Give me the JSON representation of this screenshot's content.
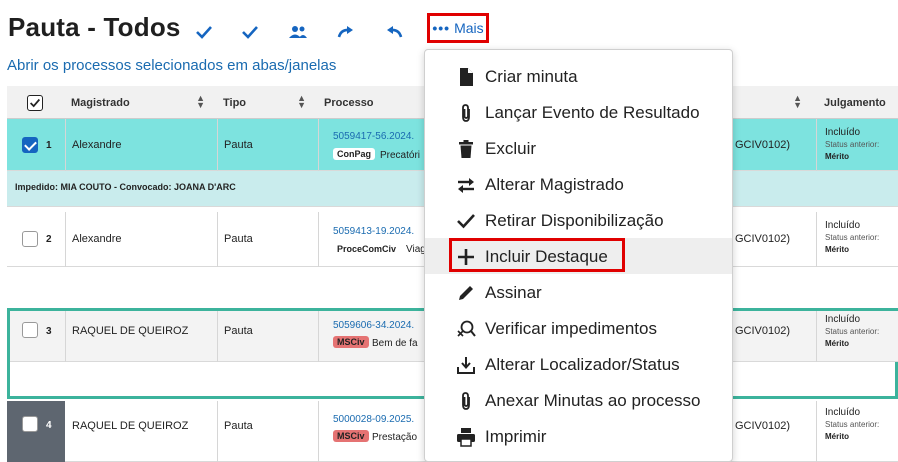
{
  "header": {
    "title": "Pauta - Todos",
    "mais_label": "Mais",
    "open_link": "Abrir os processos selecionados em abas/janelas"
  },
  "toolbar_icons": [
    "check-icon",
    "check-icon",
    "users-icon",
    "redo-icon",
    "undo-icon"
  ],
  "table": {
    "columns": [
      "Magistrado",
      "Tipo",
      "Processo",
      "Julgamento"
    ],
    "rows": [
      {
        "num": "1",
        "checked": true,
        "magistrado": "Alexandre",
        "tipo": "Pauta",
        "processo": "5059417-56.2024.",
        "tag": "ConPag",
        "tag_desc": "Precatóri",
        "code": "GCIV0102)",
        "julgamento": "Incluído",
        "status_anterior": "Status anterior:",
        "merito": "Mérito"
      },
      {
        "num": "2",
        "checked": false,
        "magistrado": "Alexandre",
        "tipo": "Pauta",
        "processo": "5059413-19.2024.",
        "tag": "ProceComCiv",
        "tag_desc": "Viag",
        "code": "GCIV0102)",
        "julgamento": "Incluído",
        "status_anterior": "Status anterior:",
        "merito": "Mérito"
      },
      {
        "num": "3",
        "checked": false,
        "magistrado": "RAQUEL DE QUEIROZ",
        "tipo": "Pauta",
        "processo": "5059606-34.2024.",
        "tag": "MSCiv",
        "tag_desc": "Bem de fa",
        "code": "GCIV0102)",
        "julgamento": "Incluído",
        "status_anterior": "Status anterior:",
        "merito": "Mérito"
      },
      {
        "num": "4",
        "checked": false,
        "magistrado": "RAQUEL DE QUEIROZ",
        "tipo": "Pauta",
        "processo": "5000028-09.2025.",
        "tag": "MSCiv",
        "tag_desc": "Prestação",
        "code": "GCIV0102)",
        "julgamento": "Incluído",
        "status_anterior": "Status anterior:",
        "merito": "Mérito"
      }
    ],
    "impedido_note": "Impedido: MIA COUTO - Convocado: JOANA D'ARC"
  },
  "menu": {
    "items": [
      {
        "label": "Criar minuta",
        "icon": "file-icon"
      },
      {
        "label": "Lançar Evento de Resultado",
        "icon": "paperclip-icon"
      },
      {
        "label": "Excluir",
        "icon": "trash-icon"
      },
      {
        "label": "Alterar Magistrado",
        "icon": "swap-icon"
      },
      {
        "label": "Retirar Disponibilização",
        "icon": "check-icon"
      },
      {
        "label": "Incluir Destaque",
        "icon": "plus-icon"
      },
      {
        "label": "Assinar",
        "icon": "pen-icon"
      },
      {
        "label": "Verificar impedimentos",
        "icon": "search-x-icon"
      },
      {
        "label": "Alterar Localizador/Status",
        "icon": "download-icon"
      },
      {
        "label": "Anexar Minutas ao processo",
        "icon": "paperclip-icon"
      },
      {
        "label": "Imprimir",
        "icon": "print-icon"
      }
    ],
    "highlighted": "Incluir Destaque"
  },
  "colors": {
    "accent": "#1565c0",
    "selected_row": "#7de3df",
    "impedido_row": "#c9eced",
    "highlight_red": "#e00000",
    "tag_red": "#e57373"
  }
}
